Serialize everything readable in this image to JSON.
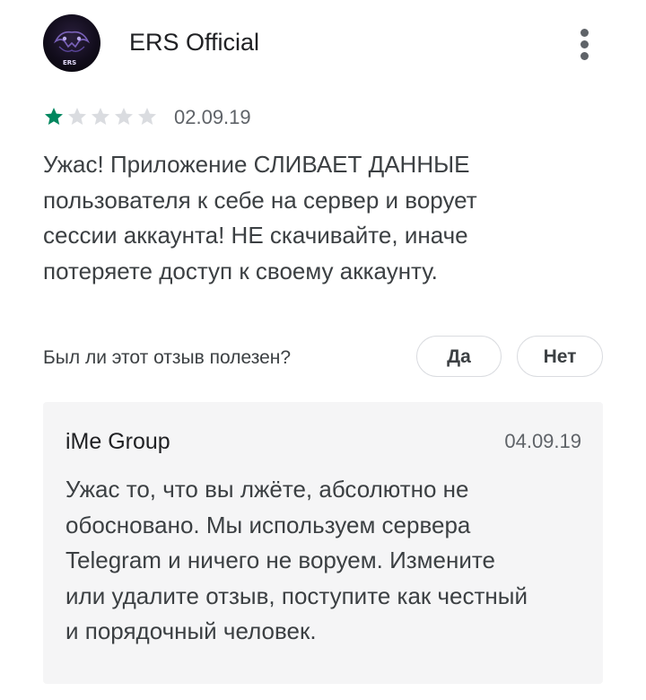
{
  "review": {
    "author_name": "ERS Official",
    "avatar_text": "ERS",
    "avatar_icon": "avatar-logo-icon",
    "more_icon": "more-vert-icon",
    "rating": 1,
    "rating_max": 5,
    "date": "02.09.19",
    "text_lines": [
      "Ужас! Приложение СЛИВАЕТ ДАННЫЕ",
      "пользователя к себе на сервер и ворует",
      "сессии аккаунта! НЕ скачивайте, иначе",
      "потеряете доступ к своему аккаунту."
    ],
    "star_filled_color": "#01875f",
    "star_empty_color": "#dadce0"
  },
  "helpful": {
    "question": "Был ли этот отзыв полезен?",
    "yes_label": "Да",
    "no_label": "Нет"
  },
  "developer_reply": {
    "name": "iMe Group",
    "date": "04.09.19",
    "text_lines": [
      "Ужас то, что вы лжёте, абсолютно не",
      "обосновано. Мы используем сервера",
      "Telegram и ничего не воруем. Измените",
      "или удалите отзыв, поступите как честный",
      "и порядочный человек."
    ]
  }
}
